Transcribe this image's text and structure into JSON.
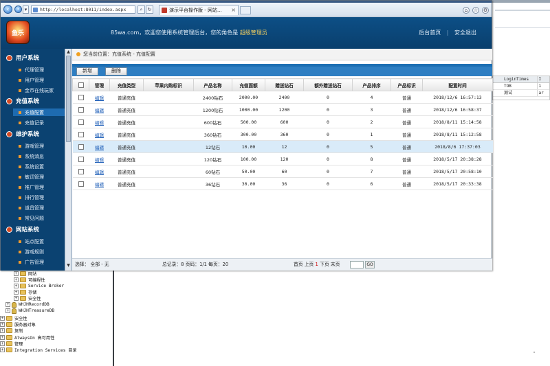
{
  "browser": {
    "url": "http://localhost:8011/index.aspx",
    "tab_title": "演示平台操作版 - 网站...",
    "tab_close": "×"
  },
  "header": {
    "logo_text": "鱼乐",
    "site": "85wa.com",
    "welcome_text": "，欢迎您使用系统管理后台，您的角色是",
    "role": "超级管理员",
    "home_link": "后台首页",
    "separator": "|",
    "logout_link": "安全退出"
  },
  "sidebar": {
    "groups": [
      {
        "label": "用户系统",
        "items": [
          "代理管理",
          "用户管理",
          "金币在线玩家"
        ]
      },
      {
        "label": "充值系统",
        "items": [
          "充值配置",
          "充值记录"
        ]
      },
      {
        "label": "维护系统",
        "items": [
          "游戏管理",
          "系统消息",
          "系统设置",
          "敏词管理",
          "推广管理",
          "排行管理",
          "道具管理",
          "常见问题"
        ]
      },
      {
        "label": "网站系统",
        "items": [
          "站点配置",
          "游戏规则",
          "广告管理"
        ]
      }
    ],
    "active_item": "充值配置"
  },
  "breadcrumb": "您当前位置：充值系统 - 充值配置",
  "toolbar": {
    "add_label": "新增",
    "delete_label": "删除"
  },
  "table": {
    "headers": [
      "管理",
      "充值类型",
      "苹果内购标识",
      "产品名称",
      "充值面额",
      "赠送钻石",
      "额外赠送钻石",
      "产品排序",
      "产品标识",
      "配置时间"
    ],
    "edit_label": "编辑",
    "rows": [
      {
        "type": "普通充值",
        "apple_id": "",
        "name": "2400钻石",
        "amount": "2000.00",
        "gift": "2400",
        "extra": "0",
        "order": "4",
        "tag": "普通",
        "time": "2018/12/6 16:57:13"
      },
      {
        "type": "普通充值",
        "apple_id": "",
        "name": "1200钻石",
        "amount": "1000.00",
        "gift": "1200",
        "extra": "0",
        "order": "3",
        "tag": "普通",
        "time": "2018/12/6 16:58:37"
      },
      {
        "type": "普通充值",
        "apple_id": "",
        "name": "600钻石",
        "amount": "500.00",
        "gift": "600",
        "extra": "0",
        "order": "2",
        "tag": "普通",
        "time": "2018/8/11 15:14:58"
      },
      {
        "type": "普通充值",
        "apple_id": "",
        "name": "360钻石",
        "amount": "300.00",
        "gift": "360",
        "extra": "0",
        "order": "1",
        "tag": "普通",
        "time": "2018/8/11 15:12:58"
      },
      {
        "type": "普通充值",
        "apple_id": "",
        "name": "12钻石",
        "amount": "10.00",
        "gift": "12",
        "extra": "0",
        "order": "5",
        "tag": "普通",
        "time": "2018/8/6 17:37:03"
      },
      {
        "type": "普通充值",
        "apple_id": "",
        "name": "120钻石",
        "amount": "100.00",
        "gift": "120",
        "extra": "0",
        "order": "8",
        "tag": "普通",
        "time": "2018/5/17 20:38:28"
      },
      {
        "type": "普通充值",
        "apple_id": "",
        "name": "60钻石",
        "amount": "50.00",
        "gift": "60",
        "extra": "0",
        "order": "7",
        "tag": "普通",
        "time": "2018/5/17 20:58:10"
      },
      {
        "type": "普通充值",
        "apple_id": "",
        "name": "36钻石",
        "amount": "30.00",
        "gift": "36",
        "extra": "0",
        "order": "6",
        "tag": "普通",
        "time": "2018/5/17 20:33:38"
      }
    ],
    "selected_row": 4
  },
  "footer": {
    "select_text": "选择：  全部 - 无",
    "stats_text": "总记录：8    页码：1/1    每页：20",
    "pager_first": "首页",
    "pager_prev": "上页",
    "pager_current": "1",
    "pager_next": "下页",
    "pager_last": "末页",
    "go_label": "GO"
  },
  "background": {
    "grid_header": [
      "LoginTimes",
      "I"
    ],
    "grid_rows": [
      [
        "TOB",
        "1"
      ],
      [
        "测试",
        "ar"
      ]
    ],
    "tree": [
      "网站",
      "可编程性",
      "Service Broker",
      "存储",
      "安全性",
      "WHJHRecordDB",
      "WHJHTreasureDB",
      "安全性",
      "服务器对象",
      "复制",
      "AlwaysOn 高可用性",
      "管理",
      "Integration Services 目录"
    ]
  },
  "colors": {
    "header_blue": "#0c4f86",
    "sidebar_blue": "#0b4271",
    "accent_orange": "#f09a2e",
    "link_blue": "#1f5fb8",
    "selected_row": "#d9ebf9"
  }
}
